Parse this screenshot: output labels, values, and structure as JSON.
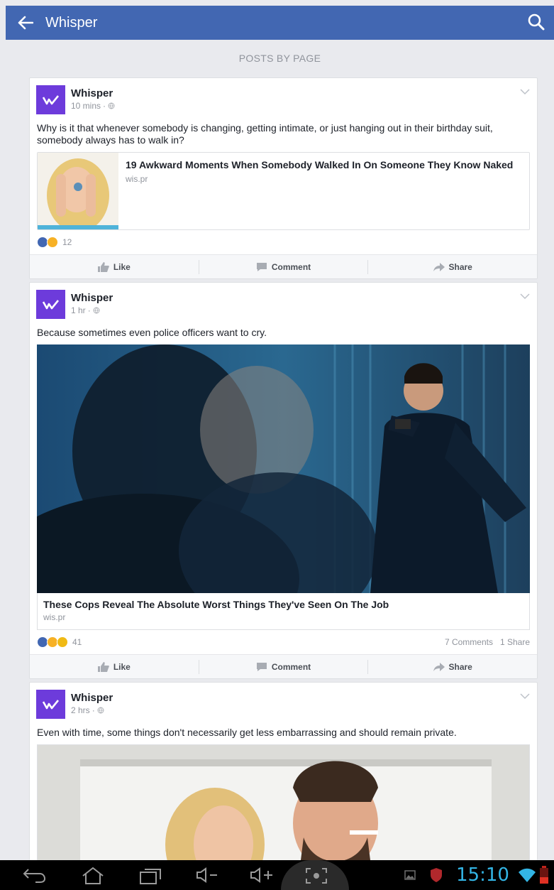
{
  "appbar": {
    "title": "Whisper",
    "back_icon": "arrow-left-icon",
    "search_icon": "search-icon",
    "color": "#4267b2"
  },
  "section_label": "POSTS BY PAGE",
  "posts": [
    {
      "author": "Whisper",
      "time": "10 mins",
      "text": "Why is it that whenever somebody is changing, getting intimate, or just hanging out in their birthday suit, somebody always has to walk in?",
      "link_title": "19 Awkward Moments When Somebody Walked In On Someone They Know Naked",
      "link_domain": "wis.pr",
      "reaction_count": "12",
      "reactions": [
        "like",
        "haha"
      ]
    },
    {
      "author": "Whisper",
      "time": "1 hr",
      "text": "Because sometimes even police officers want to cry.",
      "link_title": "These Cops Reveal The Absolute Worst Things They've Seen On The Job",
      "link_domain": "wis.pr",
      "reaction_count": "41",
      "comments": "7 Comments",
      "shares": "1 Share",
      "reactions": [
        "like",
        "sad",
        "wow"
      ]
    },
    {
      "author": "Whisper",
      "time": "2 hrs",
      "text": "Even with time, some things don't necessarily get less embarrassing and should remain private."
    }
  ],
  "actions": {
    "like": "Like",
    "comment": "Comment",
    "share": "Share"
  },
  "statusbar": {
    "time": "15:10"
  }
}
